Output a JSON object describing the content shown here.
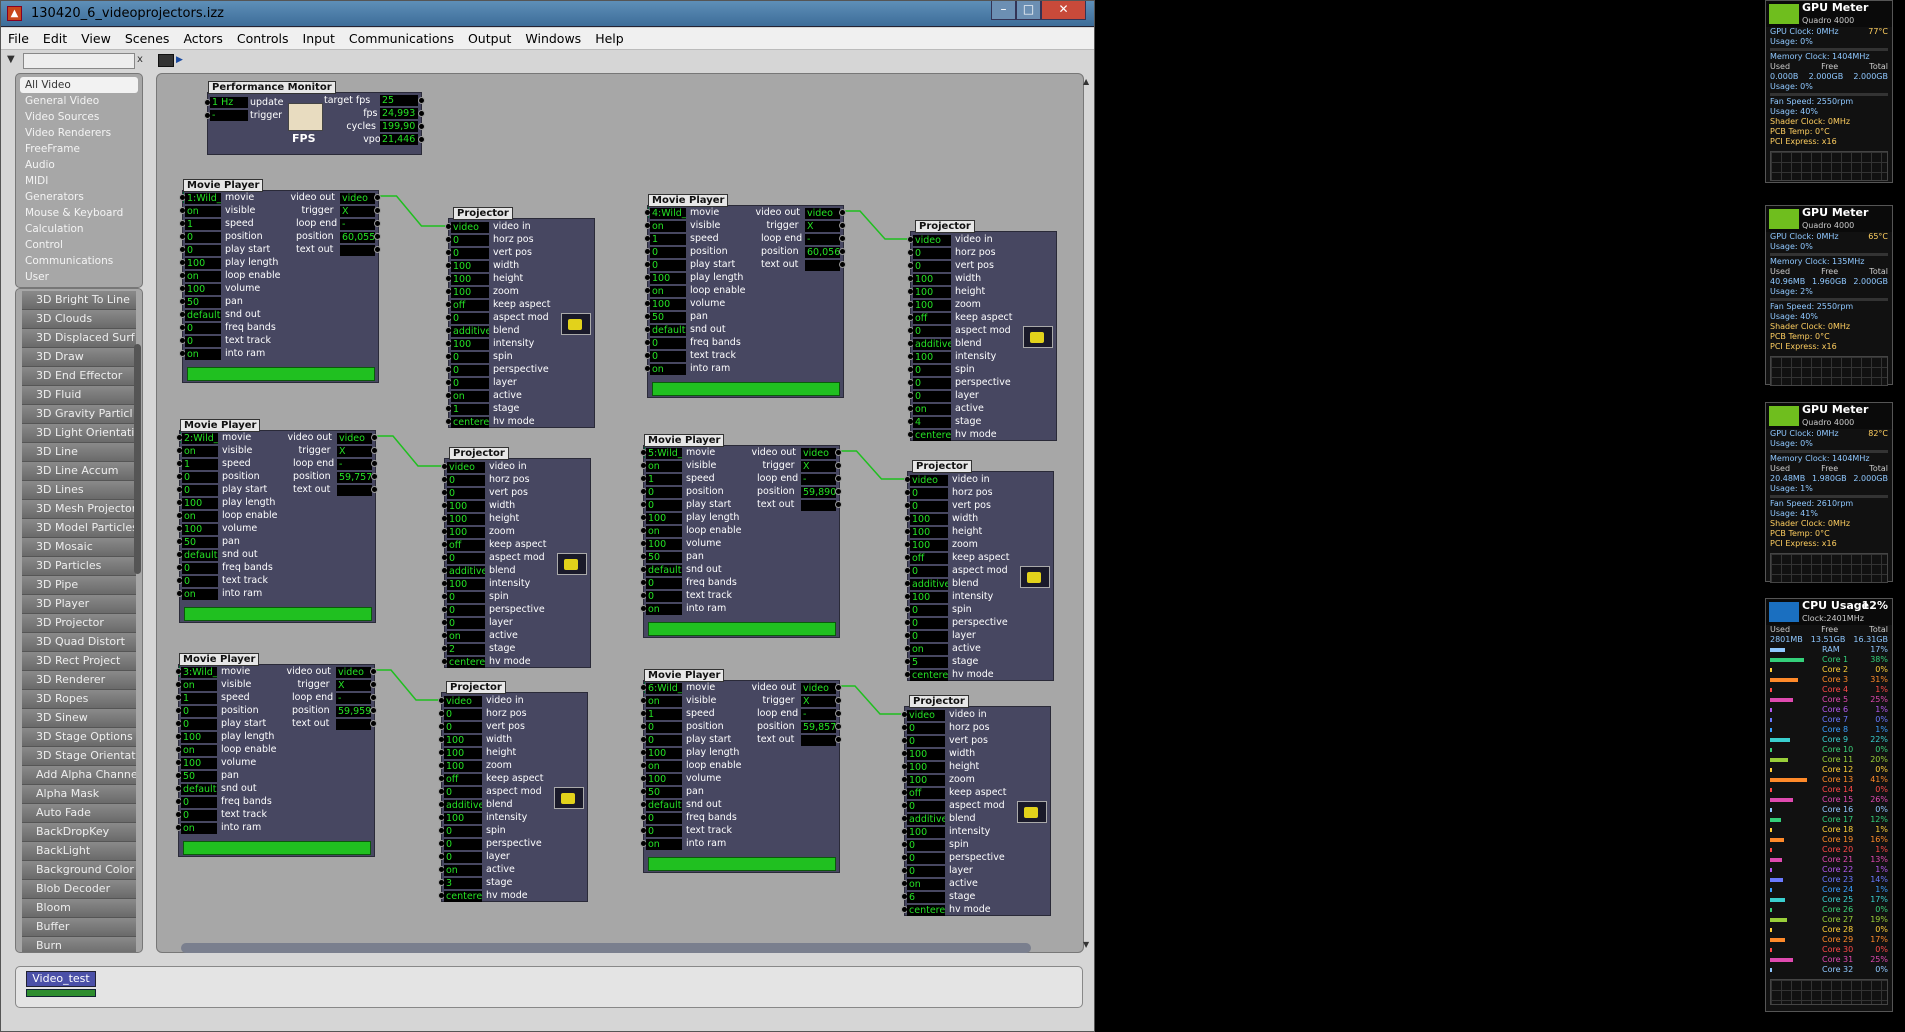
{
  "window": {
    "title": "130420_6_videoprojectors.izz"
  },
  "menu": [
    "File",
    "Edit",
    "View",
    "Scenes",
    "Actors",
    "Controls",
    "Input",
    "Communications",
    "Output",
    "Windows",
    "Help"
  ],
  "categories": [
    "All Video",
    "General Video",
    "Video Sources",
    "Video Renderers",
    "FreeFrame",
    "Audio",
    "MIDI",
    "Generators",
    "Mouse & Keyboard",
    "Calculation",
    "Control",
    "Communications",
    "User"
  ],
  "actors_list": [
    "3D Bright To Line",
    "3D Clouds",
    "3D Displaced Surf",
    "3D Draw",
    "3D End Effector",
    "3D Fluid",
    "3D Gravity Particl",
    "3D Light Orientati",
    "3D Line",
    "3D Line Accum",
    "3D Lines",
    "3D Mesh Projector",
    "3D Model Particles",
    "3D Mosaic",
    "3D Particles",
    "3D Pipe",
    "3D Player",
    "3D Projector",
    "3D Quad Distort",
    "3D Rect Project",
    "3D Renderer",
    "3D Ropes",
    "3D Sinew",
    "3D Stage Options",
    "3D Stage Orientat",
    "Add Alpha Channe",
    "Alpha Mask",
    "Auto Fade",
    "BackDropKey",
    "BackLight",
    "Background Color",
    "Blob Decoder",
    "Bloom",
    "Buffer",
    "Burn"
  ],
  "perf": {
    "title": "Performance Monitor",
    "inputs": [
      {
        "v": "1 Hz",
        "l": "update"
      },
      {
        "v": "-",
        "l": "trigger"
      }
    ],
    "outputs": [
      {
        "l": "target fps",
        "v": "25"
      },
      {
        "l": "fps",
        "v": "24,993"
      },
      {
        "l": "cycles",
        "v": "199,90"
      },
      {
        "l": "vpo",
        "v": "21,446"
      }
    ],
    "icon_label": "FPS"
  },
  "mp_labels_in": [
    "movie",
    "visible",
    "speed",
    "position",
    "play start",
    "play length",
    "loop enable",
    "volume",
    "pan",
    "snd out",
    "freq bands",
    "text track",
    "into ram"
  ],
  "mp_labels_out": [
    "video out",
    "trigger",
    "loop end",
    "position",
    "text out"
  ],
  "movie_players": [
    {
      "title": "Movie Player",
      "vals": [
        "1:Wild_",
        "on",
        "1",
        "0",
        "0",
        "100",
        "on",
        "100",
        "50",
        "default",
        "0",
        "0",
        "on"
      ],
      "outs": [
        "video",
        "X",
        "-",
        "60,055",
        ""
      ]
    },
    {
      "title": "Movie Player",
      "vals": [
        "2:Wild_",
        "on",
        "1",
        "0",
        "0",
        "100",
        "on",
        "100",
        "50",
        "default",
        "0",
        "0",
        "on"
      ],
      "outs": [
        "video",
        "X",
        "-",
        "59,757",
        ""
      ]
    },
    {
      "title": "Movie Player",
      "vals": [
        "3:Wild_",
        "on",
        "1",
        "0",
        "0",
        "100",
        "on",
        "100",
        "50",
        "default",
        "0",
        "0",
        "on"
      ],
      "outs": [
        "video",
        "X",
        "-",
        "59,959",
        ""
      ]
    },
    {
      "title": "Movie Player",
      "vals": [
        "4:Wild_",
        "on",
        "1",
        "0",
        "0",
        "100",
        "on",
        "100",
        "50",
        "default",
        "0",
        "0",
        "on"
      ],
      "outs": [
        "video",
        "X",
        "-",
        "60,056",
        ""
      ]
    },
    {
      "title": "Movie Player",
      "vals": [
        "5:Wild_",
        "on",
        "1",
        "0",
        "0",
        "100",
        "on",
        "100",
        "50",
        "default",
        "0",
        "0",
        "on"
      ],
      "outs": [
        "video",
        "X",
        "-",
        "59,890",
        ""
      ]
    },
    {
      "title": "Movie Player",
      "vals": [
        "6:Wild_",
        "on",
        "1",
        "0",
        "0",
        "100",
        "on",
        "100",
        "50",
        "default",
        "0",
        "0",
        "on"
      ],
      "outs": [
        "video",
        "X",
        "-",
        "59,857",
        ""
      ]
    }
  ],
  "proj_labels": [
    "video in",
    "horz pos",
    "vert pos",
    "width",
    "height",
    "zoom",
    "keep aspect",
    "aspect mod",
    "blend",
    "intensity",
    "spin",
    "perspective",
    "layer",
    "active",
    "stage",
    "hv mode"
  ],
  "projectors": [
    {
      "title": "Projector",
      "vals": [
        "video",
        "0",
        "0",
        "100",
        "100",
        "100",
        "off",
        "0",
        "additive",
        "100",
        "0",
        "0",
        "0",
        "on",
        "1",
        "centere"
      ]
    },
    {
      "title": "Projector",
      "vals": [
        "video",
        "0",
        "0",
        "100",
        "100",
        "100",
        "off",
        "0",
        "additive",
        "100",
        "0",
        "0",
        "0",
        "on",
        "2",
        "centere"
      ]
    },
    {
      "title": "Projector",
      "vals": [
        "video",
        "0",
        "0",
        "100",
        "100",
        "100",
        "off",
        "0",
        "additive",
        "100",
        "0",
        "0",
        "0",
        "on",
        "3",
        "centere"
      ]
    },
    {
      "title": "Projector",
      "vals": [
        "video",
        "0",
        "0",
        "100",
        "100",
        "100",
        "off",
        "0",
        "additive",
        "100",
        "0",
        "0",
        "0",
        "on",
        "4",
        "centere"
      ]
    },
    {
      "title": "Projector",
      "vals": [
        "video",
        "0",
        "0",
        "100",
        "100",
        "100",
        "off",
        "0",
        "additive",
        "100",
        "0",
        "0",
        "0",
        "on",
        "5",
        "centere"
      ]
    },
    {
      "title": "Projector",
      "vals": [
        "video",
        "0",
        "0",
        "100",
        "100",
        "100",
        "off",
        "0",
        "additive",
        "100",
        "0",
        "0",
        "0",
        "on",
        "6",
        "centere"
      ]
    }
  ],
  "scene": {
    "name": "Video_test"
  },
  "gpu_meters": [
    {
      "title": "GPU Meter",
      "model": "Quadro 4000",
      "clock": "GPU Clock: 0MHz",
      "temp": "77°C",
      "usage": "Usage: 0%",
      "mem_clock": "Memory Clock: 1404MHz",
      "hdr": [
        "Used",
        "Free",
        "Total"
      ],
      "mem": [
        "0.000B",
        "2.000GB",
        "2.000GB"
      ],
      "mem_usage": "Usage: 0%",
      "fan": "Fan Speed: 2550rpm",
      "fan_usage": "Usage: 40%",
      "shader": "Shader Clock: 0MHz",
      "pcb": "PCB Temp: 0°C",
      "pci": "PCI Express: x16"
    },
    {
      "title": "GPU Meter",
      "model": "Quadro 4000",
      "clock": "GPU Clock: 0MHz",
      "temp": "65°C",
      "usage": "Usage: 0%",
      "mem_clock": "Memory Clock: 135MHz",
      "hdr": [
        "Used",
        "Free",
        "Total"
      ],
      "mem": [
        "40.96MB",
        "1.960GB",
        "2.000GB"
      ],
      "mem_usage": "Usage: 2%",
      "fan": "Fan Speed: 2550rpm",
      "fan_usage": "Usage: 40%",
      "shader": "Shader Clock: 0MHz",
      "pcb": "PCB Temp: 0°C",
      "pci": "PCI Express: x16"
    },
    {
      "title": "GPU Meter",
      "model": "Quadro 4000",
      "clock": "GPU Clock: 0MHz",
      "temp": "82°C",
      "usage": "Usage: 0%",
      "mem_clock": "Memory Clock: 1404MHz",
      "hdr": [
        "Used",
        "Free",
        "Total"
      ],
      "mem": [
        "20.48MB",
        "1.980GB",
        "2.000GB"
      ],
      "mem_usage": "Usage: 1%",
      "fan": "Fan Speed: 2610rpm",
      "fan_usage": "Usage: 41%",
      "shader": "Shader Clock: 0MHz",
      "pcb": "PCB Temp: 0°C",
      "pci": "PCI Express: x16"
    }
  ],
  "cpu": {
    "title": "CPU Usage",
    "total": "12%",
    "clock": "Clock:2401MHz",
    "hdr": [
      "Used",
      "Free",
      "Total"
    ],
    "mem": [
      "2801MB",
      "13.51GB",
      "16.31GB"
    ],
    "rows": [
      [
        "RAM",
        "17%"
      ],
      [
        "Core 1",
        "38%"
      ],
      [
        "Core 2",
        "0%"
      ],
      [
        "Core 3",
        "31%"
      ],
      [
        "Core 4",
        "1%"
      ],
      [
        "Core 5",
        "25%"
      ],
      [
        "Core 6",
        "1%"
      ],
      [
        "Core 7",
        "0%"
      ],
      [
        "Core 8",
        "1%"
      ],
      [
        "Core 9",
        "22%"
      ],
      [
        "Core 10",
        "0%"
      ],
      [
        "Core 11",
        "20%"
      ],
      [
        "Core 12",
        "0%"
      ],
      [
        "Core 13",
        "41%"
      ],
      [
        "Core 14",
        "0%"
      ],
      [
        "Core 15",
        "26%"
      ],
      [
        "Core 16",
        "0%"
      ],
      [
        "Core 17",
        "12%"
      ],
      [
        "Core 18",
        "1%"
      ],
      [
        "Core 19",
        "16%"
      ],
      [
        "Core 20",
        "1%"
      ],
      [
        "Core 21",
        "13%"
      ],
      [
        "Core 22",
        "1%"
      ],
      [
        "Core 23",
        "14%"
      ],
      [
        "Core 24",
        "1%"
      ],
      [
        "Core 25",
        "17%"
      ],
      [
        "Core 26",
        "0%"
      ],
      [
        "Core 27",
        "19%"
      ],
      [
        "Core 28",
        "0%"
      ],
      [
        "Core 29",
        "17%"
      ],
      [
        "Core 30",
        "0%"
      ],
      [
        "Core 31",
        "25%"
      ],
      [
        "Core 32",
        "0%"
      ]
    ]
  }
}
